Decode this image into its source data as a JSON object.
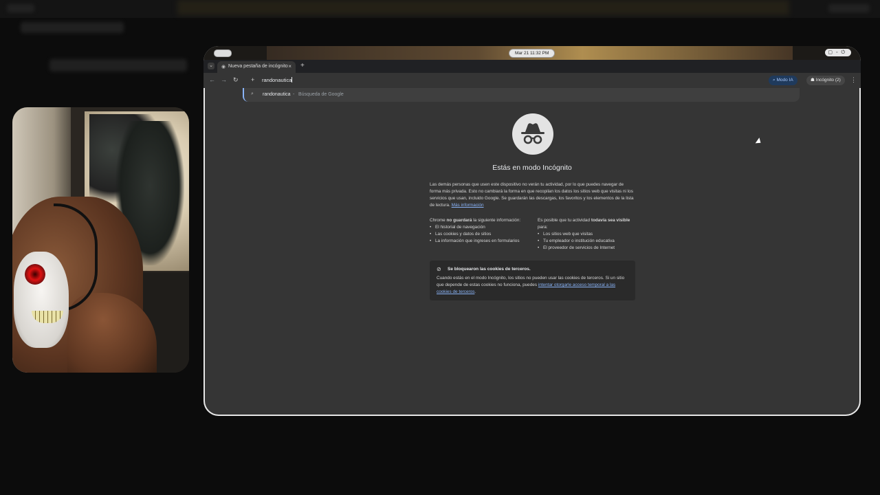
{
  "statusbar": {
    "clock": "Mar 21  11:32 PM"
  },
  "browser": {
    "tab_title": "Nueva pestaña de incógnito",
    "tab_close": "×",
    "new_tab": "+",
    "omnibox_text": "randonautica",
    "modo_ia_label": "Modo IA",
    "incognito_chip": "Incógnito (2)",
    "suggestion": {
      "query": "randonautica",
      "separator": "-",
      "hint": "Búsqueda de Google"
    }
  },
  "incognito_page": {
    "headline": "Estás en modo Incógnito",
    "intro": "Las demás personas que usen este dispositivo no verán tu actividad, por lo que puedes navegar de forma más privada. Esto no cambiará la forma en que recopilan los datos los sitios web que visitas ni los servicios que usan, incluido Google. Se guardarán las descargas, los favoritos y los elementos de la lista de lectura.",
    "learn_more": "Más información",
    "left_heading_pre": "Chrome ",
    "left_heading_bold": "no guardará",
    "left_heading_post": " la siguiente información:",
    "left_items": [
      "El historial de navegación",
      "Las cookies y datos de sitios",
      "La información que ingreses en formularios"
    ],
    "right_heading_pre": "Es posible que tu actividad ",
    "right_heading_bold": "todavía sea visible",
    "right_heading_post": " para:",
    "right_items": [
      "Los sitios web que visitas",
      "Tu empleador o institución educativa",
      "El proveedor de servicios de Internet"
    ],
    "cookie_title": "Se bloquearon las cookies de terceros.",
    "cookie_body": "Cuando estás en el modo Incógnito, los sitios no pueden usar las cookies de terceros. Si un sitio que depende de estas cookies no funciona, puedes ",
    "cookie_link": "intentar otorgarle acceso temporal a las cookies de terceros",
    "cookie_end": "."
  },
  "icons": [
    "incognito-icon",
    "search-icon",
    "lock-icon",
    "reload-icon",
    "back-icon",
    "forward-icon",
    "cookie-off-icon",
    "kebab-menu-icon"
  ],
  "colors": {
    "accent": "#8ab4f8",
    "page_bg": "#353535",
    "ia_chip": "#1f3a5c"
  }
}
